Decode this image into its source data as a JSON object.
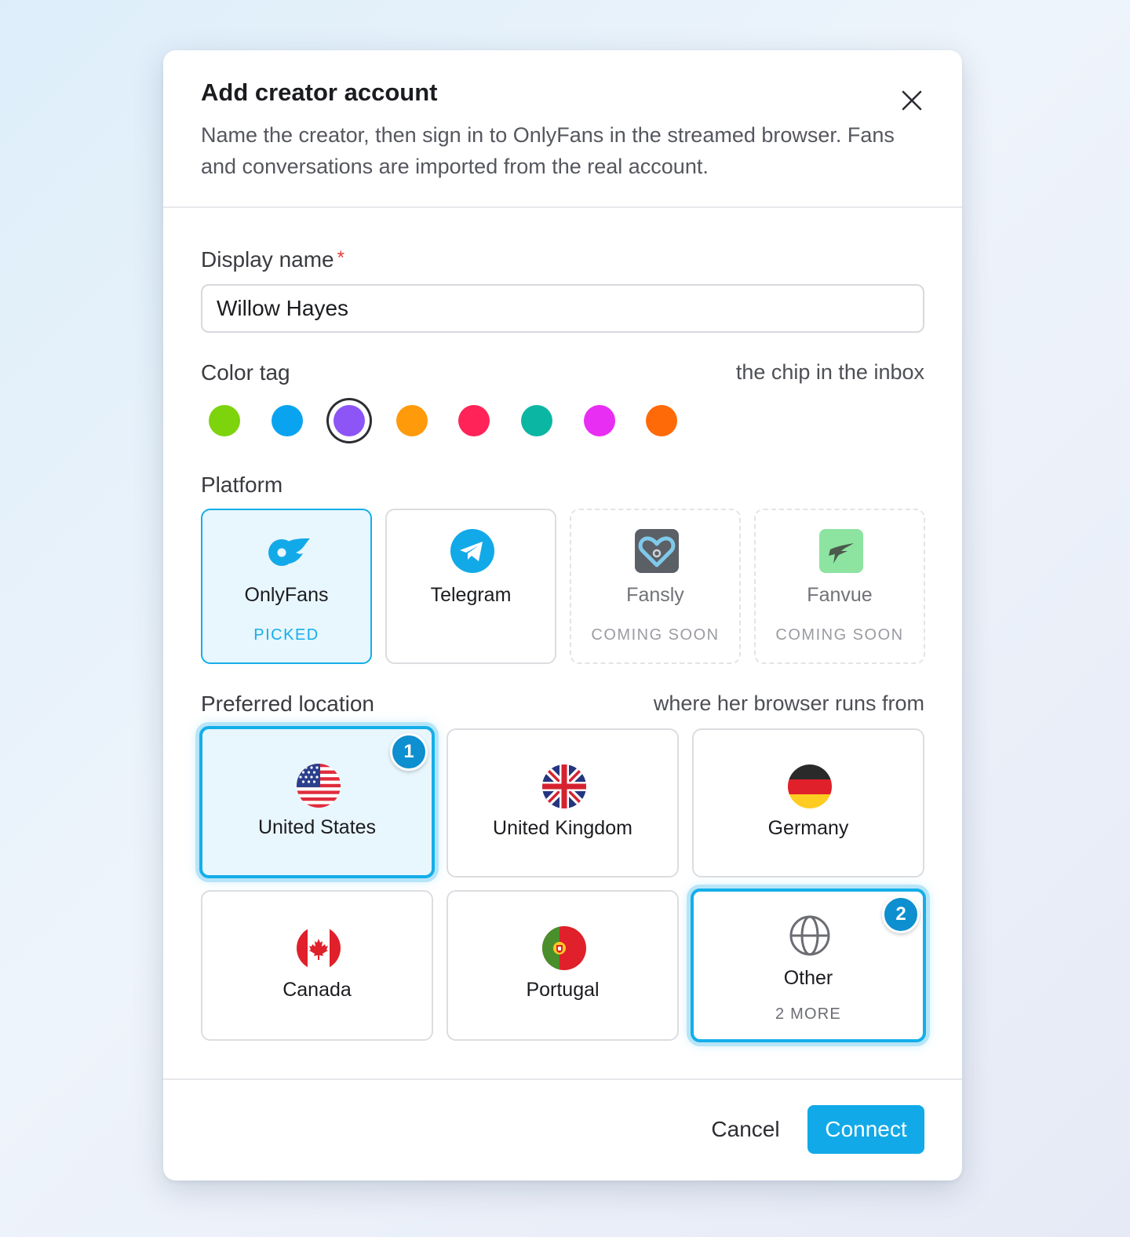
{
  "dialog": {
    "title": "Add creator account",
    "subtitle": "Name the creator, then sign in to OnlyFans in the streamed browser. Fans and conversations are imported from the real account."
  },
  "display_name": {
    "label": "Display name",
    "required_mark": "*",
    "value": "Willow Hayes"
  },
  "color_tag": {
    "label": "Color tag",
    "hint": "the chip in the inbox",
    "selected_index": 2,
    "colors": [
      "#7dd30c",
      "#0aa3f0",
      "#8d54f6",
      "#ff9a0b",
      "#ff2357",
      "#0bb6a2",
      "#e82ef2",
      "#ff6a08"
    ]
  },
  "platform": {
    "label": "Platform",
    "options": [
      {
        "name": "OnlyFans",
        "tag": "PICKED",
        "icon": "onlyfans-logo-icon",
        "state": "picked"
      },
      {
        "name": "Telegram",
        "tag": "",
        "icon": "telegram-logo-icon",
        "state": "available"
      },
      {
        "name": "Fansly",
        "tag": "COMING SOON",
        "icon": "fansly-logo-icon",
        "state": "soon"
      },
      {
        "name": "Fanvue",
        "tag": "COMING SOON",
        "icon": "fanvue-logo-icon",
        "state": "soon"
      }
    ]
  },
  "location": {
    "label": "Preferred location",
    "hint": "where her browser runs from",
    "options": [
      {
        "name": "United States",
        "icon": "us-flag-icon",
        "badge": "1"
      },
      {
        "name": "United Kingdom",
        "icon": "uk-flag-icon"
      },
      {
        "name": "Germany",
        "icon": "germany-flag-icon"
      },
      {
        "name": "Canada",
        "icon": "canada-flag-icon"
      },
      {
        "name": "Portugal",
        "icon": "portugal-flag-icon"
      },
      {
        "name": "Other",
        "icon": "globe-icon",
        "more": "2 MORE",
        "badge": "2"
      }
    ]
  },
  "actions": {
    "cancel": "Cancel",
    "connect": "Connect"
  }
}
